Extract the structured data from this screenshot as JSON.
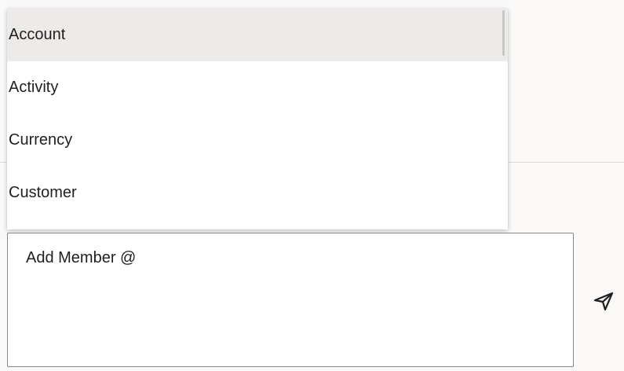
{
  "mention_dropdown": {
    "items": [
      {
        "label": "Account",
        "selected": true
      },
      {
        "label": "Activity",
        "selected": false
      },
      {
        "label": "Currency",
        "selected": false
      },
      {
        "label": "Customer",
        "selected": false
      }
    ]
  },
  "composer": {
    "text": "Add Member @"
  },
  "send_button": {
    "icon": "send-icon"
  }
}
